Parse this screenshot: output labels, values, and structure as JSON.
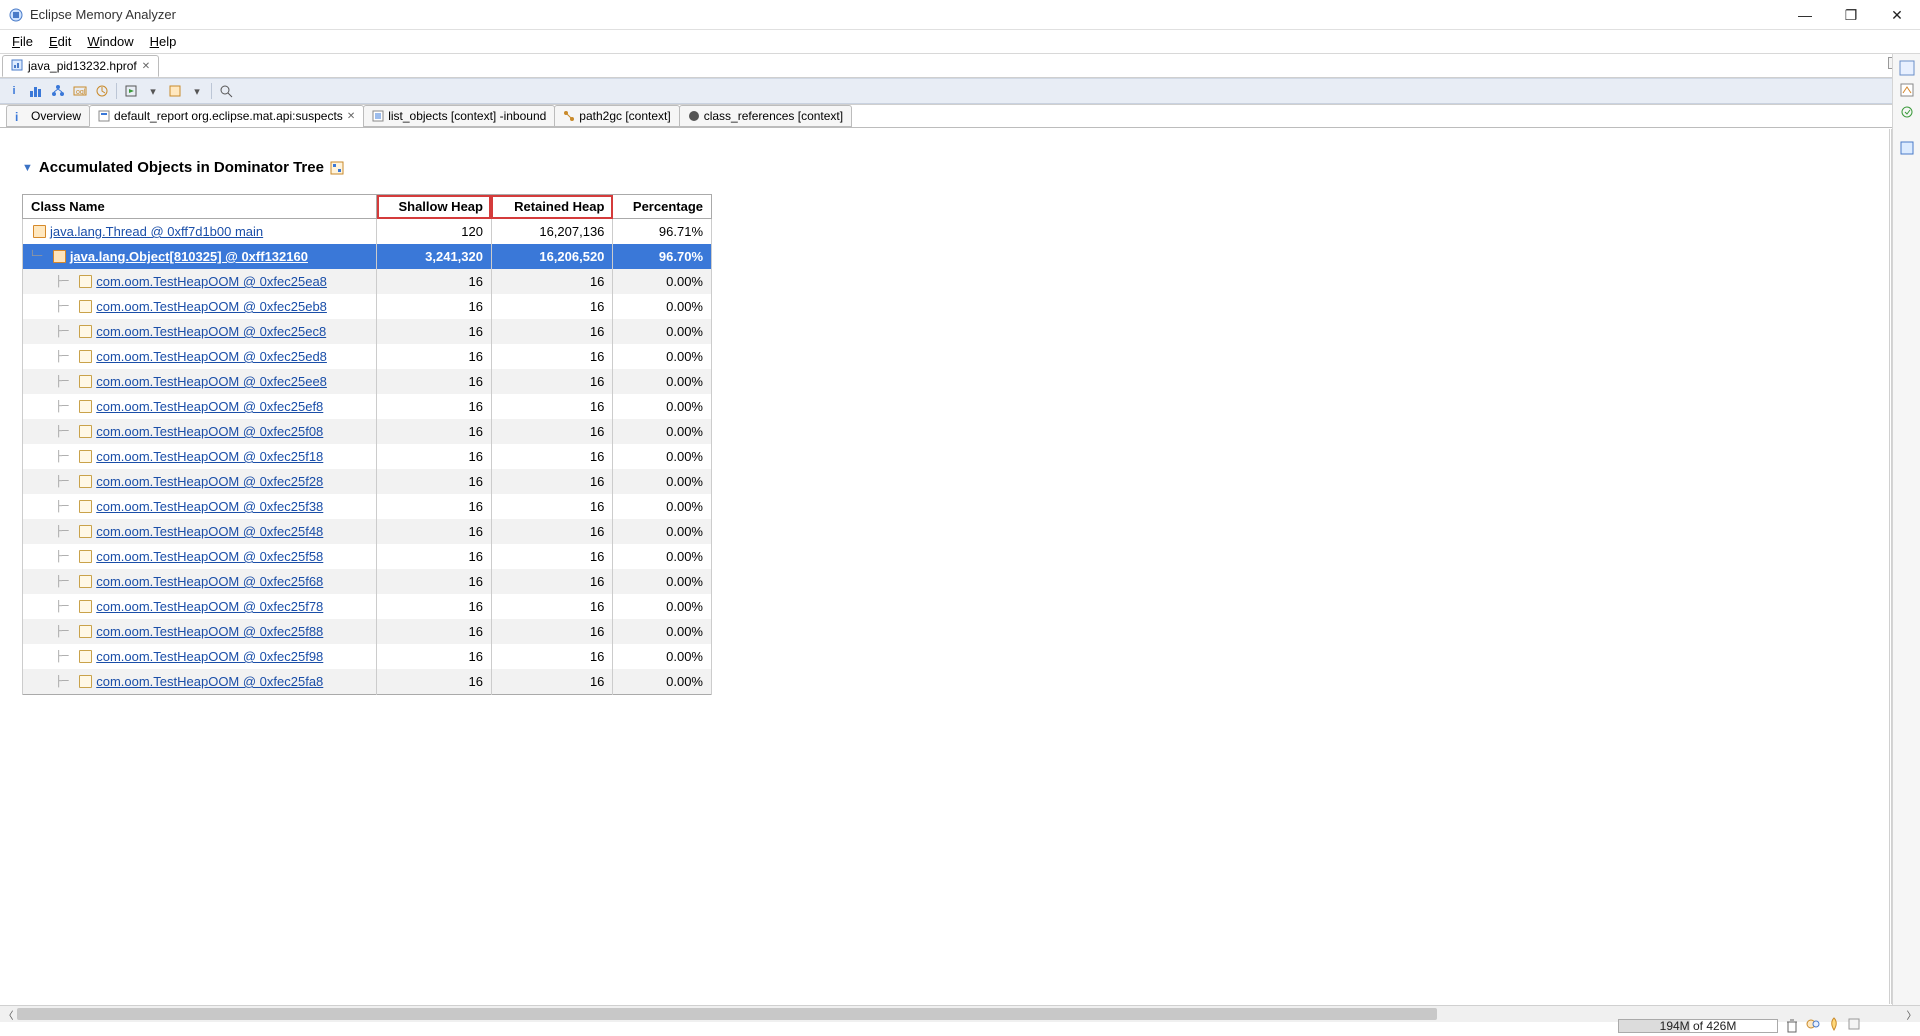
{
  "app": {
    "title": "Eclipse Memory Analyzer"
  },
  "menu": {
    "items": [
      "File",
      "Edit",
      "Window",
      "Help"
    ]
  },
  "file_tab": {
    "label": "java_pid13232.hprof"
  },
  "inner_tabs": [
    {
      "label": "Overview",
      "active": false,
      "closable": false
    },
    {
      "label": "default_report  org.eclipse.mat.api:suspects",
      "active": true,
      "closable": true
    },
    {
      "label": "list_objects  [context] -inbound",
      "active": false,
      "closable": false
    },
    {
      "label": "path2gc  [context]",
      "active": false,
      "closable": false
    },
    {
      "label": "class_references  [context]",
      "active": false,
      "closable": false
    }
  ],
  "section": {
    "title": "Accumulated Objects in Dominator Tree"
  },
  "table": {
    "headers": {
      "class": "Class Name",
      "shallow": "Shallow Heap",
      "retained": "Retained Heap",
      "pct": "Percentage"
    },
    "rows": [
      {
        "depth": 0,
        "icon": "thread",
        "name": "java.lang.Thread @ 0xff7d1b00 main",
        "shallow": "120",
        "retained": "16,207,136",
        "pct": "96.71%",
        "alt": false,
        "selected": false
      },
      {
        "depth": 1,
        "icon": "arr",
        "name": "java.lang.Object[810325] @ 0xff132160",
        "shallow": "3,241,320",
        "retained": "16,206,520",
        "pct": "96.70%",
        "alt": false,
        "selected": true
      },
      {
        "depth": 2,
        "icon": "obj",
        "name": "com.oom.TestHeapOOM @ 0xfec25ea8",
        "shallow": "16",
        "retained": "16",
        "pct": "0.00%",
        "alt": true,
        "selected": false
      },
      {
        "depth": 2,
        "icon": "obj",
        "name": "com.oom.TestHeapOOM @ 0xfec25eb8",
        "shallow": "16",
        "retained": "16",
        "pct": "0.00%",
        "alt": false,
        "selected": false
      },
      {
        "depth": 2,
        "icon": "obj",
        "name": "com.oom.TestHeapOOM @ 0xfec25ec8",
        "shallow": "16",
        "retained": "16",
        "pct": "0.00%",
        "alt": true,
        "selected": false
      },
      {
        "depth": 2,
        "icon": "obj",
        "name": "com.oom.TestHeapOOM @ 0xfec25ed8",
        "shallow": "16",
        "retained": "16",
        "pct": "0.00%",
        "alt": false,
        "selected": false
      },
      {
        "depth": 2,
        "icon": "obj",
        "name": "com.oom.TestHeapOOM @ 0xfec25ee8",
        "shallow": "16",
        "retained": "16",
        "pct": "0.00%",
        "alt": true,
        "selected": false
      },
      {
        "depth": 2,
        "icon": "obj",
        "name": "com.oom.TestHeapOOM @ 0xfec25ef8",
        "shallow": "16",
        "retained": "16",
        "pct": "0.00%",
        "alt": false,
        "selected": false
      },
      {
        "depth": 2,
        "icon": "obj",
        "name": "com.oom.TestHeapOOM @ 0xfec25f08",
        "shallow": "16",
        "retained": "16",
        "pct": "0.00%",
        "alt": true,
        "selected": false
      },
      {
        "depth": 2,
        "icon": "obj",
        "name": "com.oom.TestHeapOOM @ 0xfec25f18",
        "shallow": "16",
        "retained": "16",
        "pct": "0.00%",
        "alt": false,
        "selected": false
      },
      {
        "depth": 2,
        "icon": "obj",
        "name": "com.oom.TestHeapOOM @ 0xfec25f28",
        "shallow": "16",
        "retained": "16",
        "pct": "0.00%",
        "alt": true,
        "selected": false
      },
      {
        "depth": 2,
        "icon": "obj",
        "name": "com.oom.TestHeapOOM @ 0xfec25f38",
        "shallow": "16",
        "retained": "16",
        "pct": "0.00%",
        "alt": false,
        "selected": false
      },
      {
        "depth": 2,
        "icon": "obj",
        "name": "com.oom.TestHeapOOM @ 0xfec25f48",
        "shallow": "16",
        "retained": "16",
        "pct": "0.00%",
        "alt": true,
        "selected": false
      },
      {
        "depth": 2,
        "icon": "obj",
        "name": "com.oom.TestHeapOOM @ 0xfec25f58",
        "shallow": "16",
        "retained": "16",
        "pct": "0.00%",
        "alt": false,
        "selected": false
      },
      {
        "depth": 2,
        "icon": "obj",
        "name": "com.oom.TestHeapOOM @ 0xfec25f68",
        "shallow": "16",
        "retained": "16",
        "pct": "0.00%",
        "alt": true,
        "selected": false
      },
      {
        "depth": 2,
        "icon": "obj",
        "name": "com.oom.TestHeapOOM @ 0xfec25f78",
        "shallow": "16",
        "retained": "16",
        "pct": "0.00%",
        "alt": false,
        "selected": false
      },
      {
        "depth": 2,
        "icon": "obj",
        "name": "com.oom.TestHeapOOM @ 0xfec25f88",
        "shallow": "16",
        "retained": "16",
        "pct": "0.00%",
        "alt": true,
        "selected": false
      },
      {
        "depth": 2,
        "icon": "obj",
        "name": "com.oom.TestHeapOOM @ 0xfec25f98",
        "shallow": "16",
        "retained": "16",
        "pct": "0.00%",
        "alt": false,
        "selected": false
      },
      {
        "depth": 2,
        "icon": "obj",
        "name": "com.oom.TestHeapOOM @ 0xfec25fa8",
        "shallow": "16",
        "retained": "16",
        "pct": "0.00%",
        "alt": true,
        "selected": false
      }
    ]
  },
  "status": {
    "memory": "194M of 426M",
    "mem_pct": 45
  }
}
